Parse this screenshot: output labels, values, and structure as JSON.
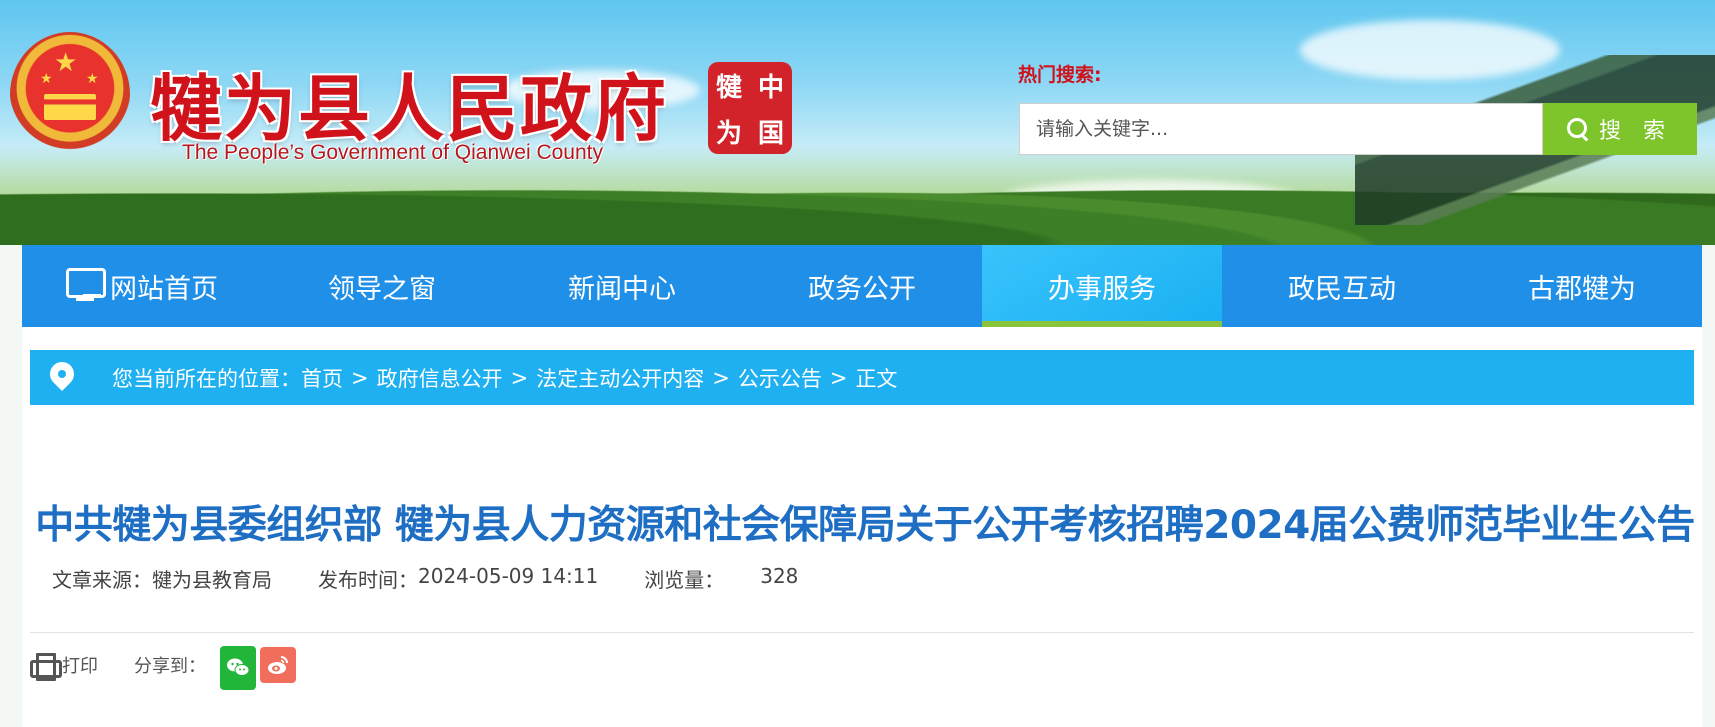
{
  "header": {
    "site_title": "犍为县人民政府",
    "site_subtitle": "The People’s Government of Qianwei County",
    "seal_chars": [
      "犍",
      "中",
      "为",
      "国"
    ],
    "hot_search_label": "热门搜索:",
    "search_placeholder": "请输入关键字...",
    "search_button_label": "搜 索"
  },
  "nav": {
    "items": [
      {
        "label": "网站首页",
        "icon": "monitor-icon"
      },
      {
        "label": "领导之窗"
      },
      {
        "label": "新闻中心"
      },
      {
        "label": "政务公开"
      },
      {
        "label": "办事服务",
        "active": true
      },
      {
        "label": "政民互动"
      },
      {
        "label": "古郡犍为"
      }
    ]
  },
  "breadcrumb": {
    "prefix": "您当前所在的位置：",
    "items": [
      "首页",
      "政府信息公开",
      "法定主动公开内容",
      "公示公告",
      "正文"
    ],
    "separator": ">"
  },
  "article": {
    "title": "中共犍为县委组织部 犍为县人力资源和社会保障局关于公开考核招聘2024届公费师范毕业生公告",
    "source_label": "文章来源：",
    "source_value": "犍为县教育局",
    "published_label": "发布时间：",
    "published_value": "2024-05-09 14:11",
    "views_label": "浏览量：",
    "views_value": "328"
  },
  "tools": {
    "print_label": "打印",
    "share_label": "分享到："
  },
  "colors": {
    "nav_bg": "#1f8fe8",
    "nav_active": "#19b0f3",
    "nav_active_underline": "#8ac43c",
    "breadcrumb_bg": "#1fb0f2",
    "title_red": "#d0121b",
    "article_title": "#1e6ec4",
    "search_button": "#7dc52a"
  }
}
